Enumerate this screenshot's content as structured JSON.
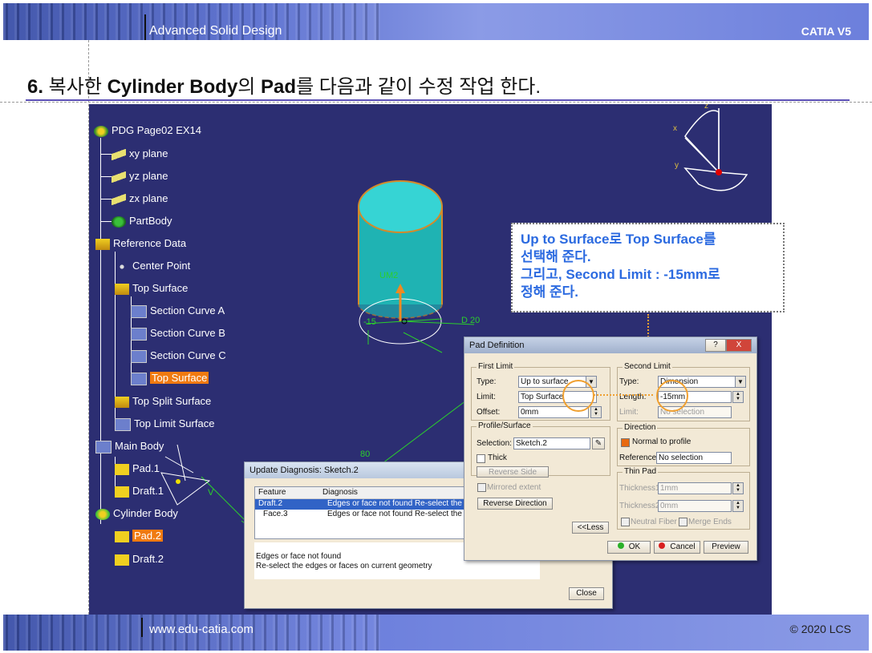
{
  "header": {
    "title": "Advanced Solid Design",
    "brand": "CATIA V5"
  },
  "footer": {
    "url": "www.edu-catia.com",
    "copyright": "© 2020 LCS"
  },
  "step": {
    "number": "6.",
    "t1": " 복사한 ",
    "b1": "Cylinder Body",
    "t2": "의 ",
    "b2": "Pad",
    "t3": "를 다음과 같이 수정 작업 한다."
  },
  "tree": {
    "root": "PDG Page02 EX14",
    "xy": "xy plane",
    "yz": "yz plane",
    "zx": "zx plane",
    "partbody": "PartBody",
    "refdata": "Reference Data",
    "center": "Center Point",
    "topsurface": "Top Surface",
    "sca": "Section Curve A",
    "scb": "Section Curve B",
    "scc": "Section Curve C",
    "topsurf_sel": "Top Surface",
    "split": "Top Split Surface",
    "limit": "Top Limit Surface",
    "mainbody": "Main Body",
    "pad1": "Pad.1",
    "draft1": "Draft.1",
    "cylbody": "Cylinder Body",
    "pad2": "Pad.2",
    "draft2": "Draft.2"
  },
  "geometry_labels": {
    "um2": "UM2",
    "d20": "D 20",
    "m15": "-15",
    "v80": "80",
    "v": "V",
    "x": "x",
    "y": "y",
    "z": "z"
  },
  "callout": {
    "line1a": "Up to Surface",
    "line1b": "로 ",
    "line1c": "Top Surface",
    "line1d": "를",
    "line2": "선택해 준다.",
    "line3a": "그리고, ",
    "line3b": "Second Limit : -15mm",
    "line3c": "로",
    "line4": "정해 준다."
  },
  "update_dialog": {
    "title": "Update Diagnosis: Sketch.2",
    "col_feature": "Feature",
    "col_diag": "Diagnosis",
    "rows": [
      {
        "feature": "Draft.2",
        "diag": "Edges or face not found Re-select the ex"
      },
      {
        "feature": "Face.3",
        "diag": "Edges or face not found Re-select the ed"
      }
    ],
    "msg1": "Edges or face not found",
    "msg2": "Re-select the edges or faces on current geometry",
    "close": "Close"
  },
  "pad_dialog": {
    "title": "Pad Definition",
    "help": "?",
    "closex": "X",
    "first_limit": "First Limit",
    "type_lbl": "Type:",
    "type_val": "Up to surface",
    "limit_lbl": "Limit:",
    "limit_val": "Top Surface",
    "offset_lbl": "Offset:",
    "offset_val": "0mm",
    "profile": "Profile/Surface",
    "sel_lbl": "Selection:",
    "sel_val": "Sketch.2",
    "thick": "Thick",
    "reverse_side": "Reverse Side",
    "mirrored": "Mirrored extent",
    "reverse_dir": "Reverse Direction",
    "second_limit": "Second Limit",
    "type2_val": "Dimension",
    "length_lbl": "Length:",
    "length_val": "-15mm",
    "limit2_lbl": "Limit:",
    "limit2_val": "No selection",
    "direction": "Direction",
    "normal": "Normal to profile",
    "ref_lbl": "Reference:",
    "ref_val": "No selection",
    "thinpad": "Thin Pad",
    "th1_lbl": "Thickness1:",
    "th1_val": "1mm",
    "th2_lbl": "Thickness2:",
    "th2_val": "0mm",
    "neutral": "Neutral Fiber",
    "merge": "Merge Ends",
    "less": "<<Less",
    "ok": "OK",
    "cancel": "Cancel",
    "preview": "Preview"
  },
  "colors": {
    "accent": "#f07a10",
    "callout_text": "#2b6ae0",
    "viewport_bg": "#2c2e72"
  }
}
